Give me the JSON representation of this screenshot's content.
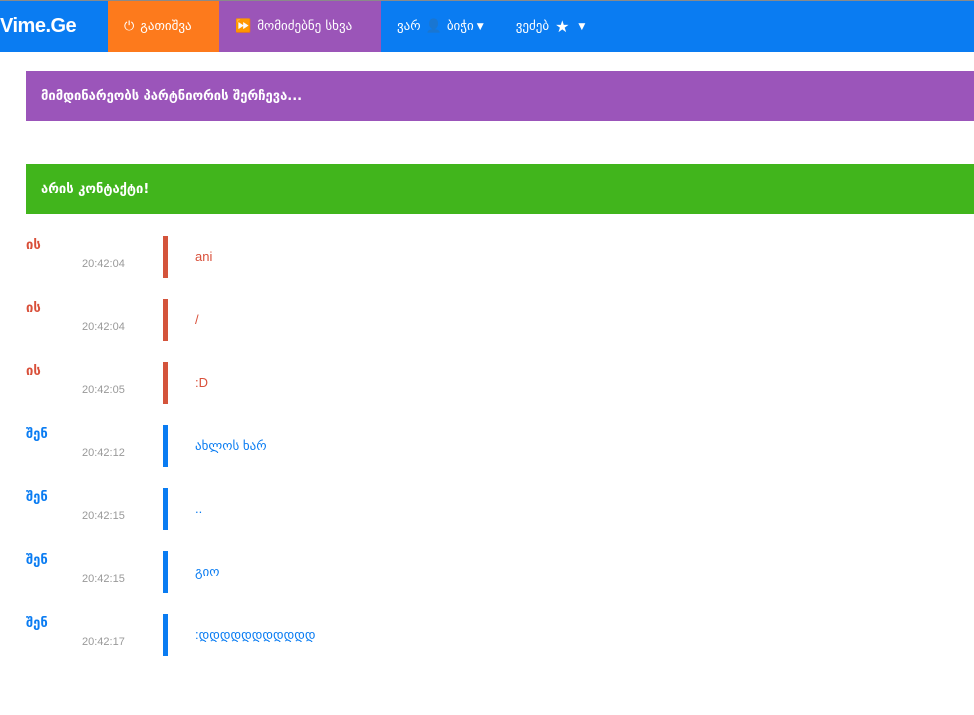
{
  "nav": {
    "logo": "Vime.Ge",
    "disconnect": "გათიშვა",
    "next": "მომიძებნე სხვა",
    "gender_prefix": "ვარ",
    "gender": "ბიჭი",
    "wants": "ვეძებ",
    "colors": {
      "nav": "#0a7cf2",
      "disconnect": "#fd7a1c",
      "next": "#9b55b8"
    }
  },
  "banners": {
    "searching": "მიმდინარეობს პარტნიორის შერჩევა...",
    "connected": "არის კონტაქტი!"
  },
  "messages": [
    {
      "sender": "ის",
      "time": "20:42:04",
      "text": "ani",
      "side": "them"
    },
    {
      "sender": "ის",
      "time": "20:42:04",
      "text": "/",
      "side": "them"
    },
    {
      "sender": "ის",
      "time": "20:42:05",
      "text": ":D",
      "side": "them"
    },
    {
      "sender": "შენ",
      "time": "20:42:12",
      "text": "ახლოს ხარ",
      "side": "me"
    },
    {
      "sender": "შენ",
      "time": "20:42:15",
      "text": "..",
      "side": "me"
    },
    {
      "sender": "შენ",
      "time": "20:42:15",
      "text": "გიო",
      "side": "me"
    },
    {
      "sender": "შენ",
      "time": "20:42:17",
      "text": ":დდდდდდდდდდდ",
      "side": "me"
    }
  ]
}
